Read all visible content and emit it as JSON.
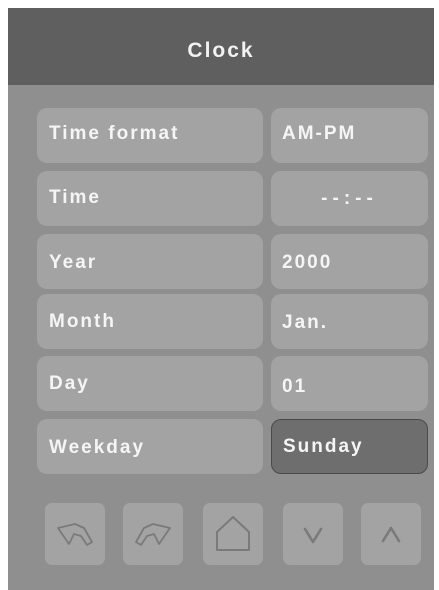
{
  "header": {
    "title": "Clock"
  },
  "rows": [
    {
      "label": "Time format",
      "value": "AM-PM"
    },
    {
      "label": "Time",
      "value": "--:--"
    },
    {
      "label": "Year",
      "value": "2000"
    },
    {
      "label": "Month",
      "value": "Jan."
    },
    {
      "label": "Day",
      "value": "01"
    },
    {
      "label": "Weekday",
      "value": "Sunday"
    }
  ],
  "toolbar": {
    "buttons": [
      {
        "icon": "undo-icon"
      },
      {
        "icon": "redo-icon"
      },
      {
        "icon": "home-icon"
      },
      {
        "icon": "chevron-down-icon"
      },
      {
        "icon": "chevron-up-icon"
      }
    ]
  },
  "colors": {
    "header_bg": "#5f5f5f",
    "panel_bg": "#8f8f8f",
    "cell_bg": "#a3a3a3",
    "selected_bg": "#6e6e6e",
    "text": "#f5f5f5",
    "icon_stroke": "#7a7a7a"
  }
}
